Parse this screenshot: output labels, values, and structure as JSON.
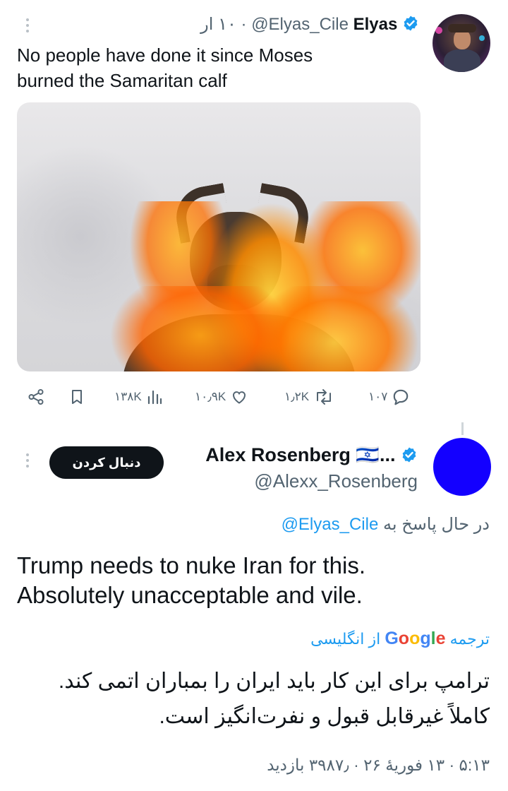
{
  "tweet": {
    "display_name": "Elyas",
    "handle": "@Elyas_Cile",
    "time": "۱۰ ار",
    "text_line1": "No people have done it since Moses",
    "text_line2": "burned the Samaritan calf",
    "actions": {
      "replies": "۱۰۷",
      "retweets": "۱٫۲K",
      "likes": "۱۰٫۹K",
      "views": "۱۳۸K"
    }
  },
  "reply": {
    "display_name": "Alex Rosenberg 🇮🇱...",
    "handle": "@Alexx_Rosenberg",
    "follow_label": "دنبال کردن",
    "replying_to_prefix": "در حال پاسخ به",
    "replying_to_handle": "@Elyas_Cile",
    "text_line1": "Trump needs to nuke Iran for this.",
    "text_line2": "Absolutely unacceptable and vile.",
    "translate_prefix": "ترجمه",
    "translate_brand": "Google",
    "translate_suffix": "از انگلیسی",
    "translation_line1": "ترامپ برای این کار باید ایران را بمباران اتمی کند.",
    "translation_line2": "کاملاً غیرقابل قبول و نفرت‌انگیز است.",
    "meta": "۵:۱۳ · ۱۳ فوریهٔ ۲۶ · ۳۹۸۷٫ بازدید"
  },
  "colors": {
    "text": "#0f1419",
    "secondary": "#536471",
    "link": "#1d9bf0",
    "verified": "#1d9bf0",
    "avatar_blue": "#1300ff"
  }
}
